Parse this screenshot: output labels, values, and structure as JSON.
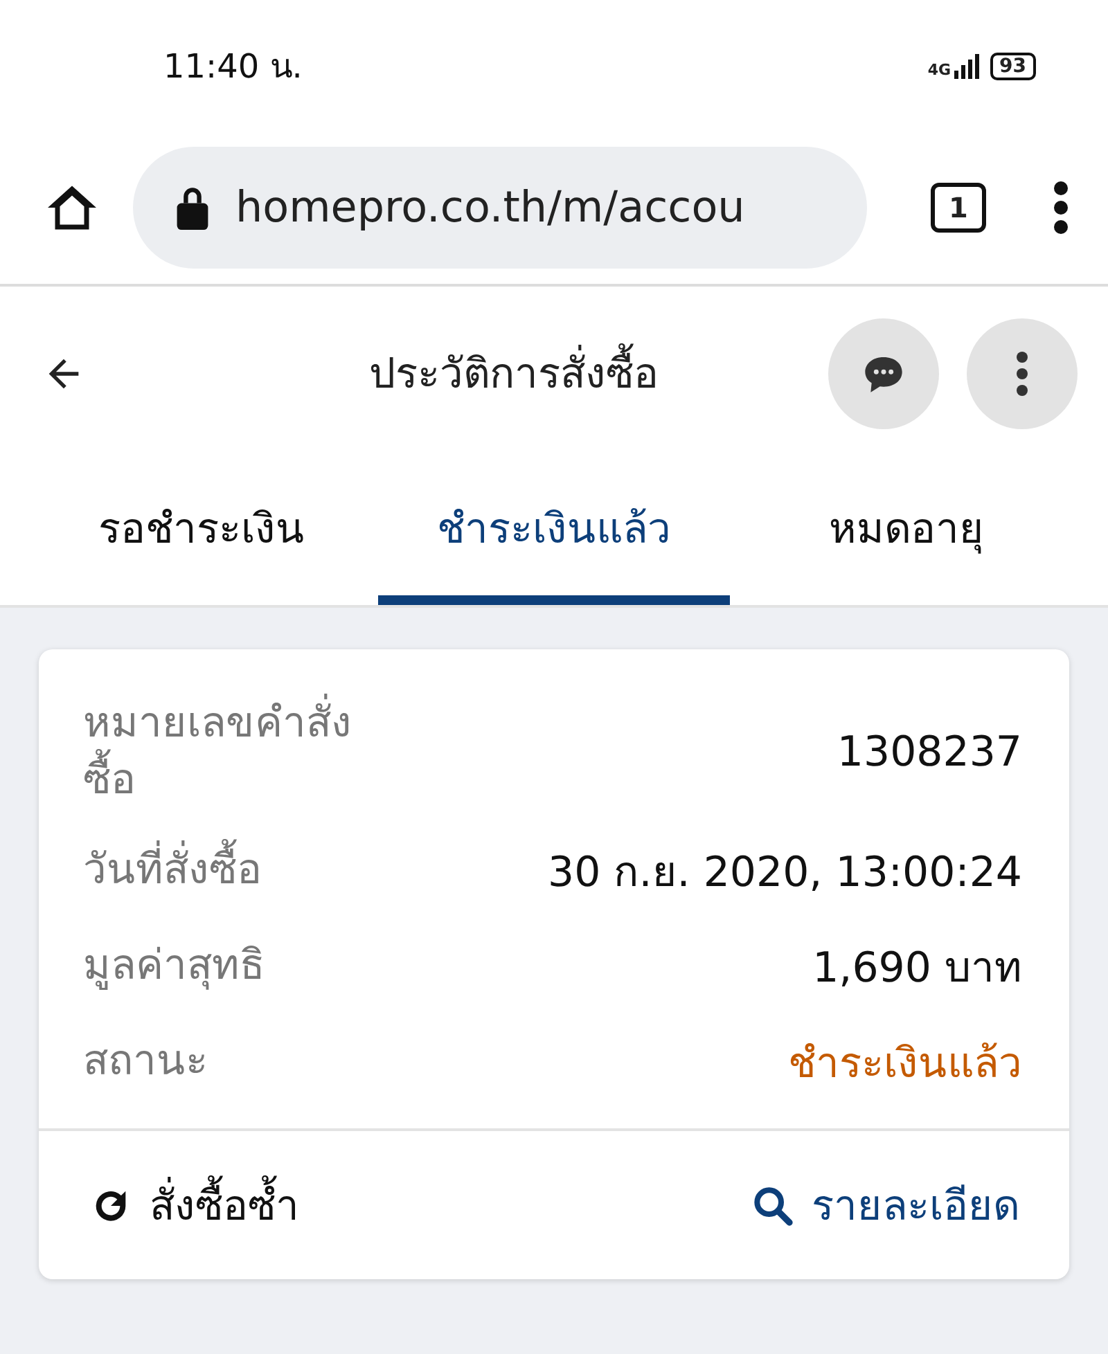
{
  "status_bar": {
    "time": "11:40 น.",
    "network": "4G",
    "battery": "93"
  },
  "browser": {
    "url": "homepro.co.th/m/accou",
    "tab_count": "1"
  },
  "header": {
    "title": "ประวัติการสั่งซื้อ"
  },
  "tabs": [
    {
      "label": "รอชำระเงิน",
      "selected": false
    },
    {
      "label": "ชำระเงินแล้ว",
      "selected": true
    },
    {
      "label": "หมดอายุ",
      "selected": false
    }
  ],
  "order": {
    "rows": [
      {
        "label": "หมายเลขคำสั่งซื้อ",
        "value": "1308237",
        "kind": "plain"
      },
      {
        "label": "วันที่สั่งซื้อ",
        "value": "30 ก.ย. 2020, 13:00:24",
        "kind": "plain"
      },
      {
        "label": "มูลค่าสุทธิ",
        "value": "1,690 บาท",
        "kind": "plain"
      },
      {
        "label": "สถานะ",
        "value": "ชำระเงินแล้ว",
        "kind": "status",
        "color": "#c45a00"
      }
    ],
    "actions": [
      {
        "label": "สั่งซื้อซ้ำ",
        "kind": "reorder"
      },
      {
        "label": "รายละเอียด",
        "kind": "details"
      }
    ]
  }
}
